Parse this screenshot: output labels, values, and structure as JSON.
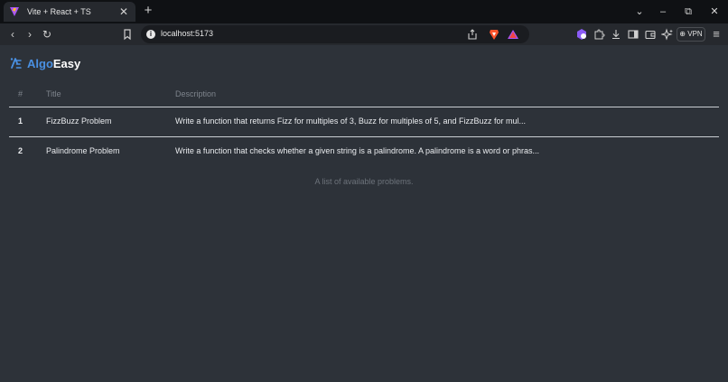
{
  "browser": {
    "tab": {
      "title": "Vite + React + TS",
      "close": "✕"
    },
    "new_tab": "+",
    "window_controls": {
      "tabs_menu": "⌄",
      "minimize": "–",
      "restore": "⧉",
      "close": "✕"
    },
    "nav": {
      "back": "‹",
      "forward": "›",
      "reload": "↻"
    },
    "address_bar": {
      "url": "localhost:5173"
    },
    "vpn_label": "VPN",
    "menu": "≡"
  },
  "app": {
    "logo": {
      "algo": "Algo",
      "easy": "Easy"
    },
    "table": {
      "headers": {
        "num": "#",
        "title": "Title",
        "description": "Description"
      },
      "rows": [
        {
          "num": "1",
          "title": "FizzBuzz Problem",
          "description": "Write a function that returns Fizz for multiples of 3, Buzz for multiples of 5, and FizzBuzz for mul..."
        },
        {
          "num": "2",
          "title": "Palindrome Problem",
          "description": "Write a function that checks whether a given string is a palindrome. A palindrome is a word or phras..."
        }
      ],
      "caption": "A list of available problems."
    }
  },
  "colors": {
    "accent": "#4a90e2",
    "page_bg": "#2d3239",
    "divider": "#c9cdd2"
  }
}
